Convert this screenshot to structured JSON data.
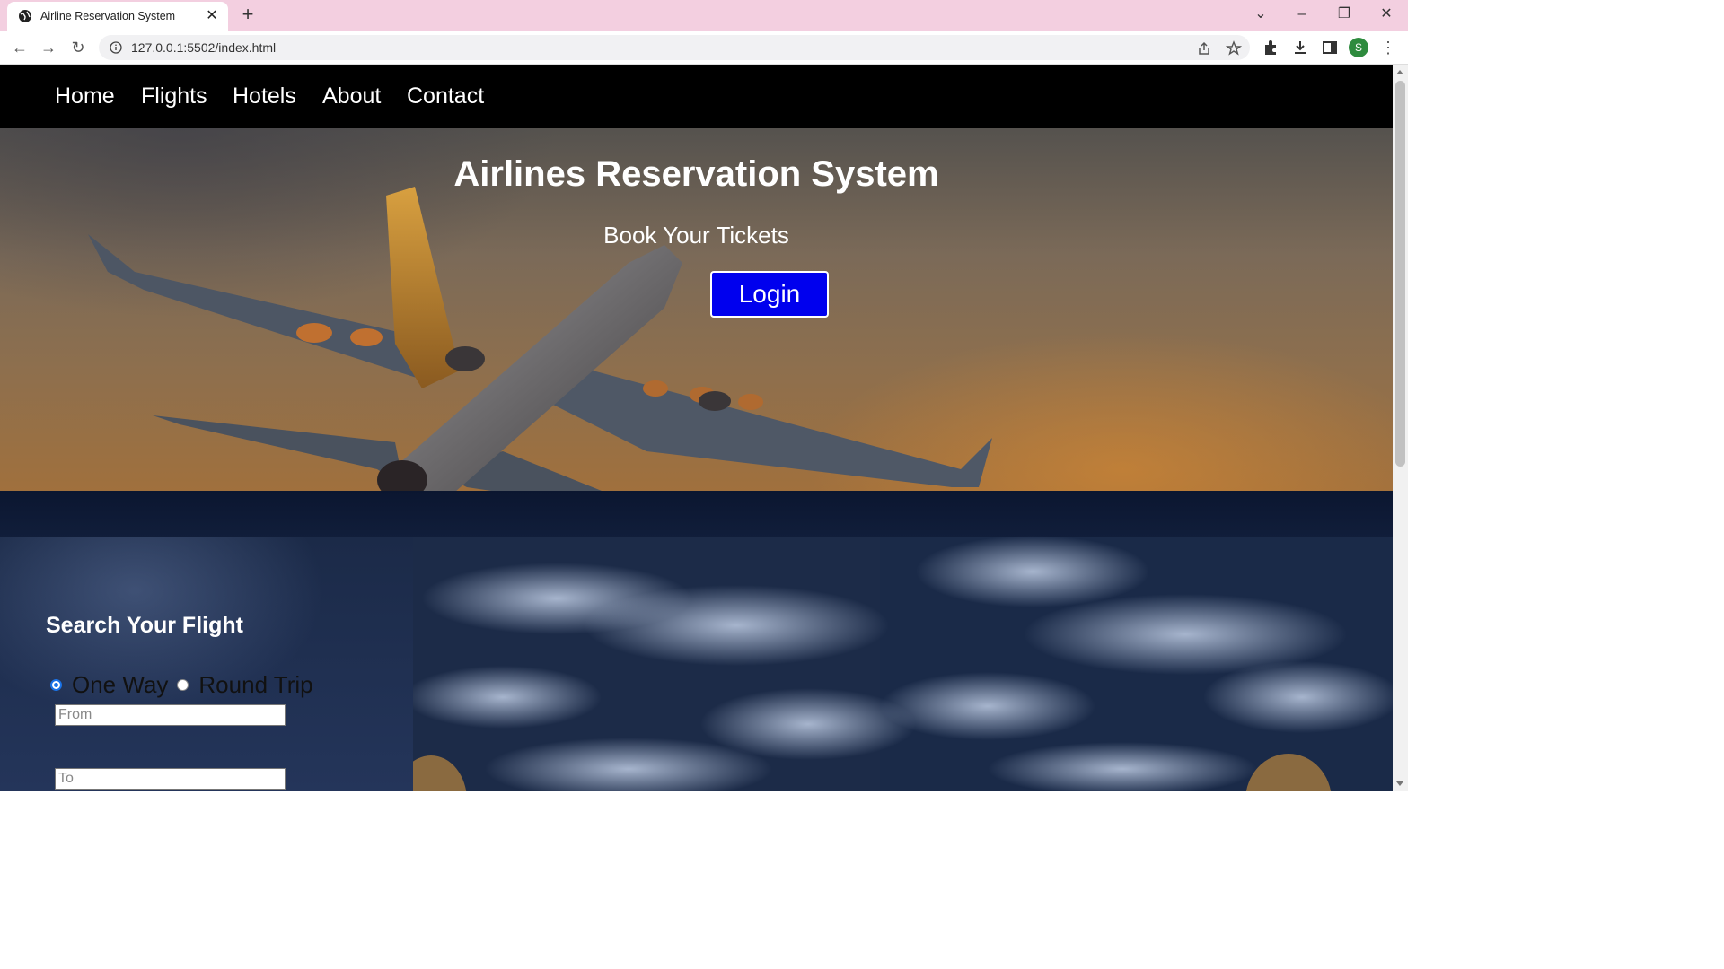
{
  "browser": {
    "tab_title": "Airline Reservation System",
    "url": "127.0.0.1:5502/index.html",
    "profile_initial": "S"
  },
  "navbar": {
    "links": [
      {
        "label": "Home"
      },
      {
        "label": "Flights"
      },
      {
        "label": "Hotels"
      },
      {
        "label": "About"
      },
      {
        "label": "Contact"
      }
    ]
  },
  "hero": {
    "title": "Airlines Reservation System",
    "subtitle": "Book Your Tickets",
    "login_label": "Login"
  },
  "search": {
    "title": "Search Your Flight",
    "trip_types": [
      "One Way",
      "Round Trip"
    ],
    "selected_trip": "One Way",
    "from_placeholder": "From",
    "to_placeholder": "To"
  },
  "colors": {
    "tabbar_bg": "#f3cfe0",
    "navbar_bg": "#000000",
    "login_button_bg": "#0000ee"
  }
}
